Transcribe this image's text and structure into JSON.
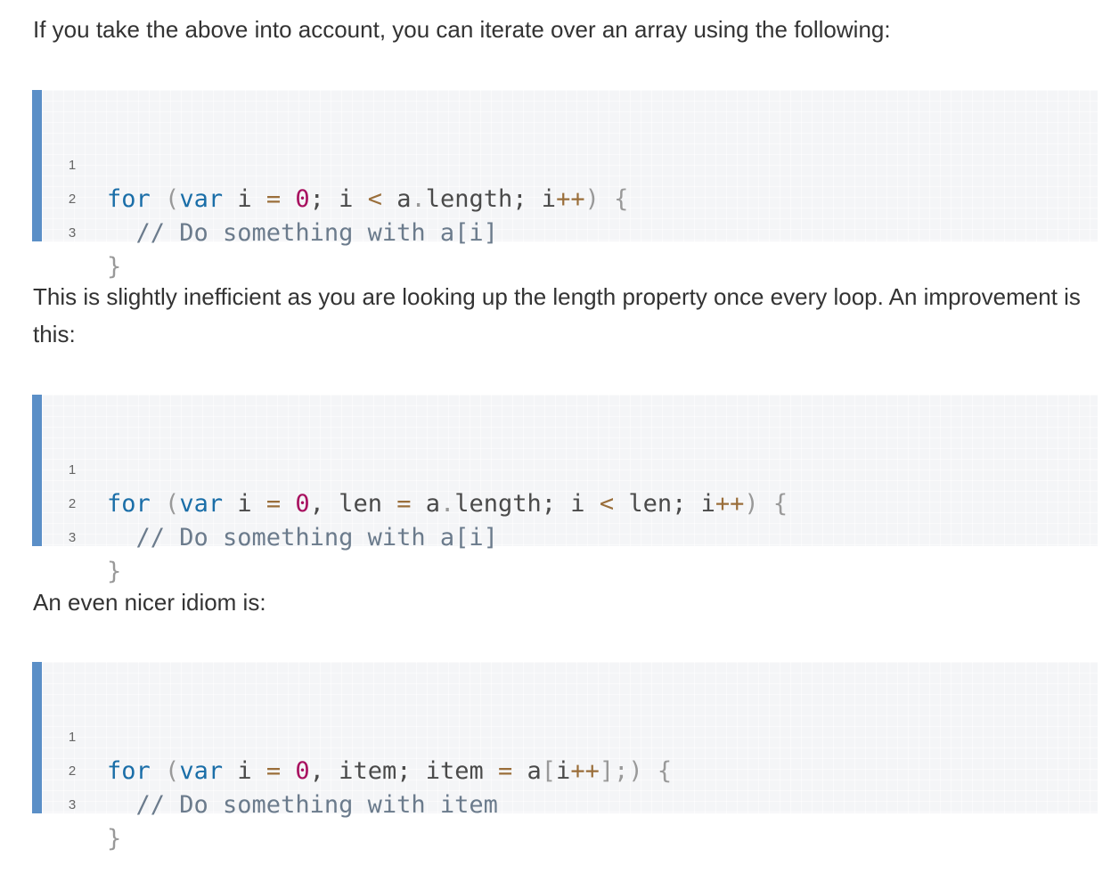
{
  "paragraphs": {
    "p1": "If you take the above into account, you can iterate over an array using the following:",
    "p2": "This is slightly inefficient as you are looking up the length property once every loop. An improvement is this:",
    "p3": "An even nicer idiom is:"
  },
  "code_blocks": [
    {
      "line_numbers": [
        "1",
        "2",
        "3"
      ],
      "line1": [
        "for",
        " ",
        "(",
        "var",
        " i ",
        "=",
        " ",
        "0",
        "; i ",
        "<",
        " a",
        ".",
        "length; i",
        "++",
        ") ",
        "{"
      ],
      "line2": "  // Do something with a[i]",
      "line3": "}"
    },
    {
      "line_numbers": [
        "1",
        "2",
        "3"
      ],
      "line1": [
        "for",
        " ",
        "(",
        "var",
        " i ",
        "=",
        " ",
        "0",
        ", len ",
        "=",
        " a",
        ".",
        "length; i ",
        "<",
        " len; i",
        "++",
        ") ",
        "{"
      ],
      "line2": "  // Do something with a[i]",
      "line3": "}"
    },
    {
      "line_numbers": [
        "1",
        "2",
        "3"
      ],
      "line1": [
        "for",
        " ",
        "(",
        "var",
        " i ",
        "=",
        " ",
        "0",
        ", item; item ",
        "=",
        " a",
        "[",
        "i",
        "++",
        "];",
        ") ",
        "{"
      ],
      "line2": "  // Do something with item",
      "line3": "}"
    }
  ],
  "colors": {
    "keyword": "#1a6ea8",
    "number": "#a8105f",
    "operator": "#9a6e3a",
    "punctuation": "#999999",
    "comment": "#6b7b8c",
    "accent_bar": "#5b8fc7"
  }
}
